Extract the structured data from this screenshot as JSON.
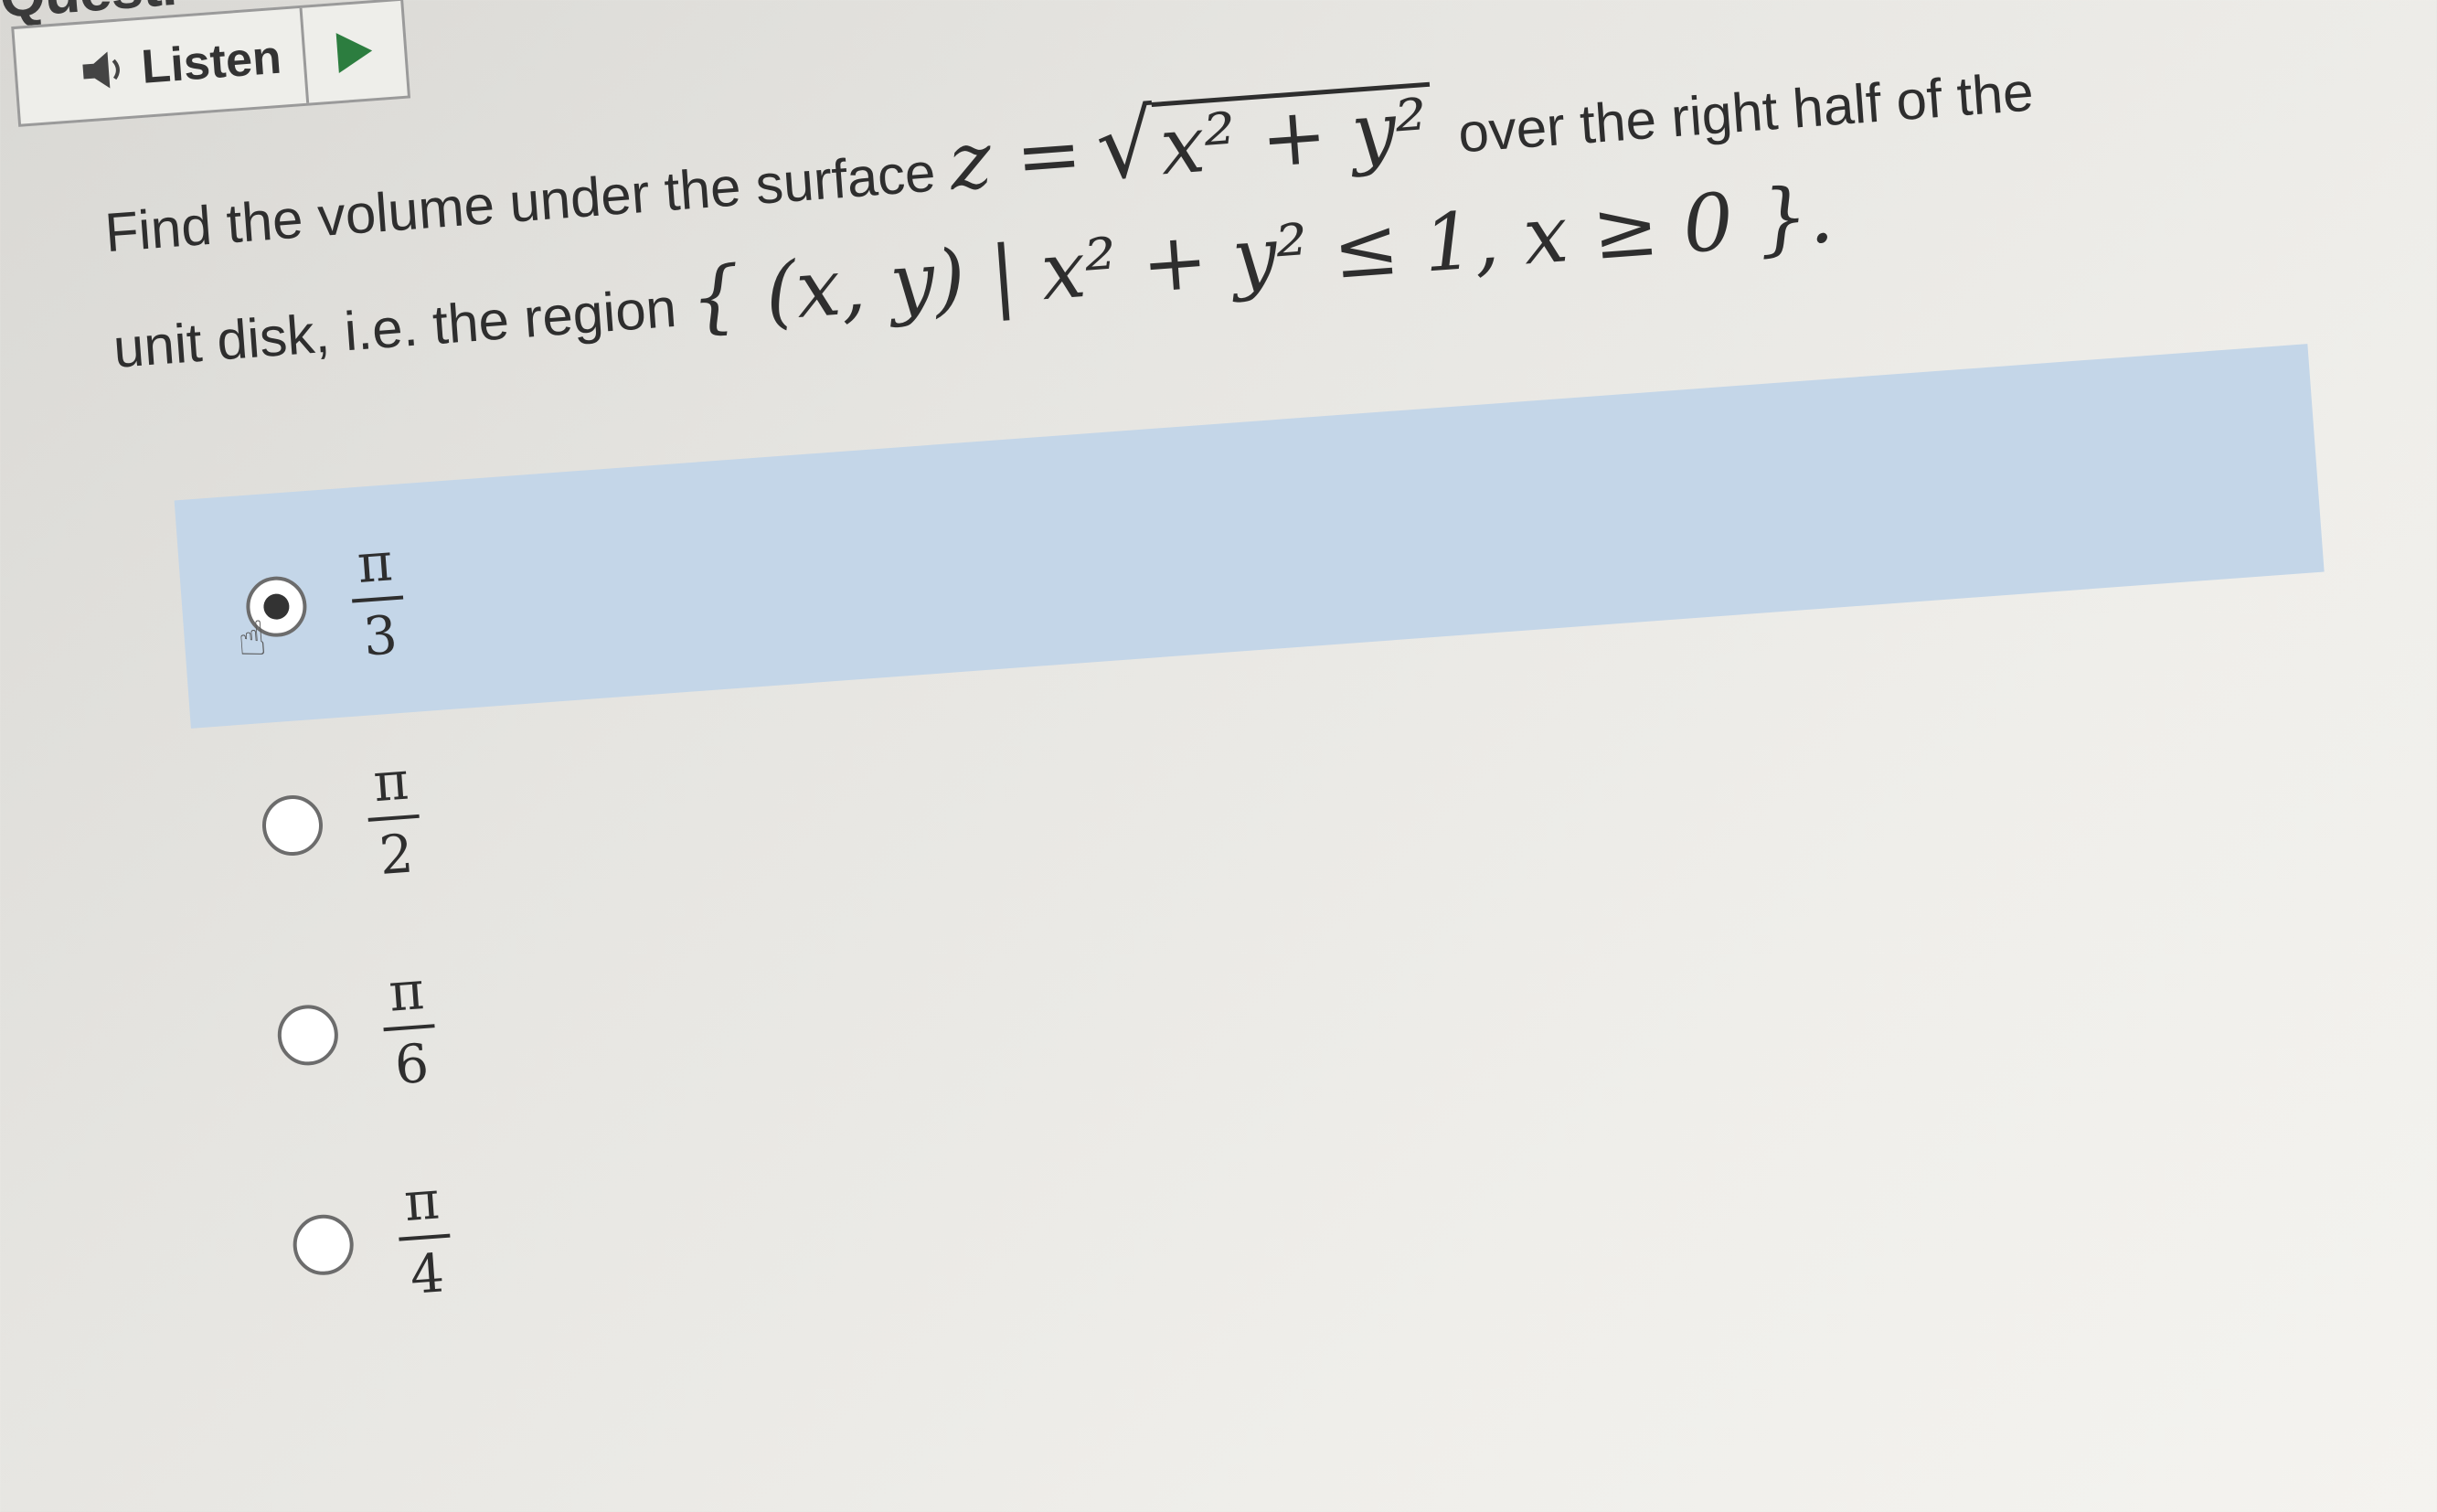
{
  "header": {
    "title_fragment": "Questi"
  },
  "listen": {
    "label": "Listen",
    "speaker_icon": "speaker-icon",
    "play_icon": "play-icon"
  },
  "question": {
    "text_1": "Find the volume under the surface",
    "equation_z": "z =",
    "sqrt_body": "x² + y²",
    "text_2": "over the right half of the",
    "text_3": "unit disk, i.e. the region",
    "region": "{ (x, y) | x² + y² ≤ 1, x ≥ 0 }."
  },
  "options": [
    {
      "numerator": "π",
      "denominator": "3",
      "selected": true
    },
    {
      "numerator": "π",
      "denominator": "2",
      "selected": false
    },
    {
      "numerator": "π",
      "denominator": "6",
      "selected": false
    },
    {
      "numerator": "π",
      "denominator": "4",
      "selected": false
    }
  ]
}
